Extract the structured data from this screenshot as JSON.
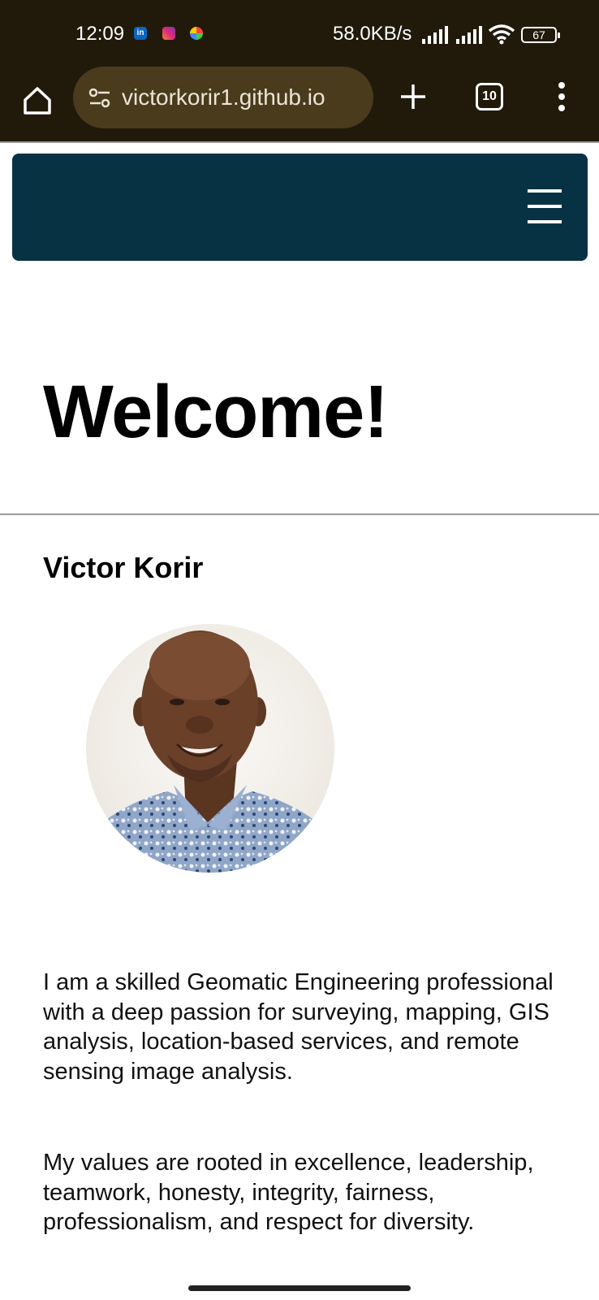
{
  "status_bar": {
    "time": "12:09",
    "network_speed": "58.0KB/s",
    "battery": "67",
    "notification_icons": [
      "linkedin-icon",
      "instagram-icon",
      "app-icon"
    ]
  },
  "browser": {
    "url": "victorkorir1.github.io",
    "tab_count": "10"
  },
  "page": {
    "heading": "Welcome!",
    "name": "Victor Korir",
    "paragraphs": [
      "I am a skilled Geomatic Engineering professional with a deep passion for surveying, mapping, GIS analysis, location-based services, and remote sensing image analysis.",
      "My values are rooted in excellence, leadership, teamwork, honesty, integrity, fairness, professionalism, and respect for diversity."
    ]
  },
  "colors": {
    "status_bg": "#211a0b",
    "urlbar_bg": "#4a3b1d",
    "nav_bg": "#073243"
  }
}
